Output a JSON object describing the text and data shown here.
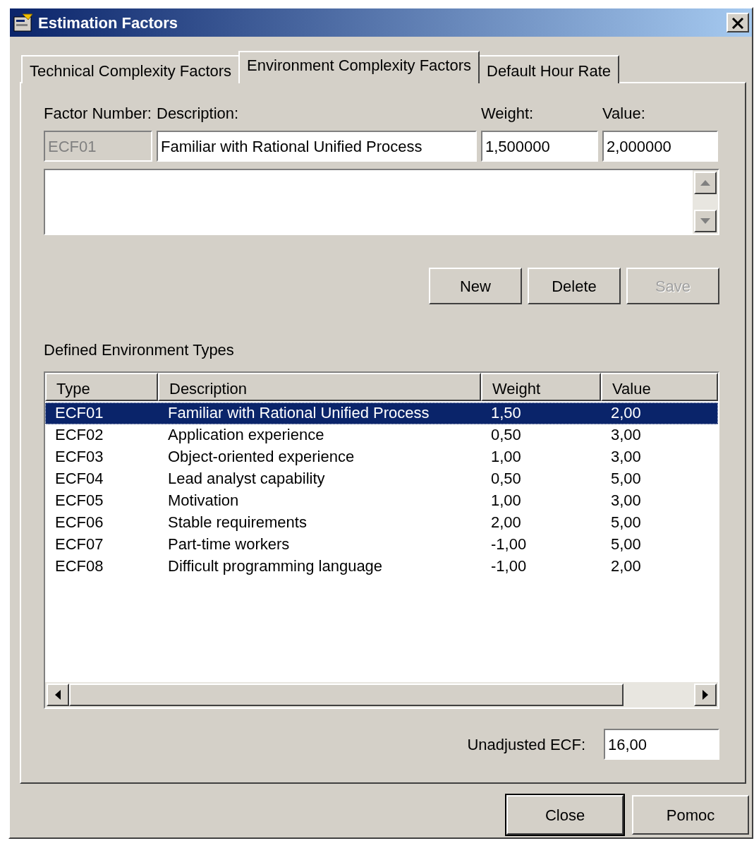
{
  "window": {
    "title": "Estimation Factors"
  },
  "tabs": [
    {
      "label": "Technical Complexity Factors",
      "selected": false
    },
    {
      "label": "Environment Complexity Factors",
      "selected": true
    },
    {
      "label": "Default Hour Rate",
      "selected": false
    }
  ],
  "fields": [
    {
      "label": "Factor Number:",
      "value": "ECF01",
      "disabled": true
    },
    {
      "label": "Description:",
      "value": "Familiar with Rational Unified Process",
      "disabled": false
    },
    {
      "label": "Weight:",
      "value": "1,500000",
      "disabled": false
    },
    {
      "label": "Value:",
      "value": "2,000000",
      "disabled": false
    }
  ],
  "buttons": [
    {
      "label": "New",
      "disabled": false
    },
    {
      "label": "Delete",
      "disabled": false
    },
    {
      "label": "Save",
      "disabled": true
    }
  ],
  "list": {
    "label": "Defined Environment Types",
    "columns": [
      "Type",
      "Description",
      "Weight",
      "Value"
    ],
    "rows": [
      {
        "cells": [
          "ECF01",
          "Familiar with Rational Unified Process",
          "1,50",
          "2,00"
        ],
        "selected": true
      },
      {
        "cells": [
          "ECF02",
          "Application experience",
          "0,50",
          "3,00"
        ],
        "selected": false
      },
      {
        "cells": [
          "ECF03",
          "Object-oriented experience",
          "1,00",
          "3,00"
        ],
        "selected": false
      },
      {
        "cells": [
          "ECF04",
          "Lead analyst capability",
          "0,50",
          "5,00"
        ],
        "selected": false
      },
      {
        "cells": [
          "ECF05",
          "Motivation",
          "1,00",
          "3,00"
        ],
        "selected": false
      },
      {
        "cells": [
          "ECF06",
          "Stable requirements",
          "2,00",
          "5,00"
        ],
        "selected": false
      },
      {
        "cells": [
          "ECF07",
          "Part-time workers",
          "-1,00",
          "5,00"
        ],
        "selected": false
      },
      {
        "cells": [
          "ECF08",
          "Difficult programming language",
          "-1,00",
          "2,00"
        ],
        "selected": false
      }
    ]
  },
  "total": {
    "label": "Unadjusted ECF:",
    "value": "16,00"
  },
  "dialog_buttons": [
    "Close",
    "Pomoc"
  ]
}
